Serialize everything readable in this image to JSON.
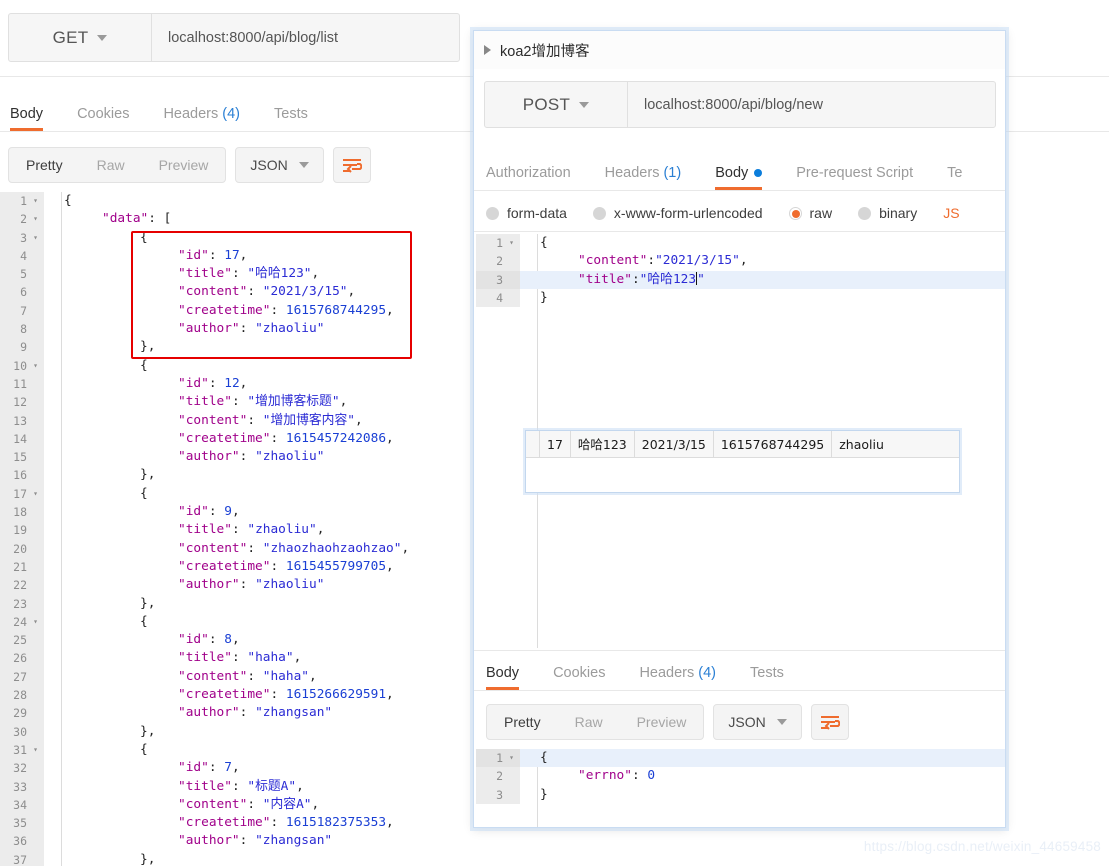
{
  "background": {
    "request": {
      "method": "GET",
      "url": "localhost:8000/api/blog/list"
    },
    "response_tabs": [
      {
        "label": "Body",
        "count": null,
        "active": true
      },
      {
        "label": "Cookies",
        "count": null,
        "active": false
      },
      {
        "label": "Headers",
        "count": "(4)",
        "active": false
      },
      {
        "label": "Tests",
        "count": null,
        "active": false
      }
    ],
    "view_modes": [
      {
        "label": "Pretty",
        "active": true
      },
      {
        "label": "Raw",
        "active": false
      },
      {
        "label": "Preview",
        "active": false
      }
    ],
    "format": "JSON",
    "wrap_icon": "word-wrap-icon",
    "body_lines": [
      {
        "n": "1",
        "fold": true,
        "indent": 0,
        "tokens": [
          [
            "p",
            "{"
          ]
        ]
      },
      {
        "n": "2",
        "fold": true,
        "indent": 1,
        "tokens": [
          [
            "k",
            "\"data\""
          ],
          [
            "p",
            ": ["
          ]
        ]
      },
      {
        "n": "3",
        "fold": true,
        "indent": 2,
        "tokens": [
          [
            "p",
            "{"
          ]
        ]
      },
      {
        "n": "4",
        "fold": false,
        "indent": 3,
        "tokens": [
          [
            "k",
            "\"id\""
          ],
          [
            "p",
            ": "
          ],
          [
            "n",
            "17"
          ],
          [
            "p",
            ","
          ]
        ]
      },
      {
        "n": "5",
        "fold": false,
        "indent": 3,
        "tokens": [
          [
            "k",
            "\"title\""
          ],
          [
            "p",
            ": "
          ],
          [
            "s",
            "\"哈哈123\""
          ],
          [
            "p",
            ","
          ]
        ]
      },
      {
        "n": "6",
        "fold": false,
        "indent": 3,
        "tokens": [
          [
            "k",
            "\"content\""
          ],
          [
            "p",
            ": "
          ],
          [
            "s",
            "\"2021/3/15\""
          ],
          [
            "p",
            ","
          ]
        ]
      },
      {
        "n": "7",
        "fold": false,
        "indent": 3,
        "tokens": [
          [
            "k",
            "\"createtime\""
          ],
          [
            "p",
            ": "
          ],
          [
            "n",
            "1615768744295"
          ],
          [
            "p",
            ","
          ]
        ]
      },
      {
        "n": "8",
        "fold": false,
        "indent": 3,
        "tokens": [
          [
            "k",
            "\"author\""
          ],
          [
            "p",
            ": "
          ],
          [
            "s",
            "\"zhaoliu\""
          ]
        ]
      },
      {
        "n": "9",
        "fold": false,
        "indent": 2,
        "tokens": [
          [
            "p",
            "},"
          ]
        ]
      },
      {
        "n": "10",
        "fold": true,
        "indent": 2,
        "tokens": [
          [
            "p",
            "{"
          ]
        ]
      },
      {
        "n": "11",
        "fold": false,
        "indent": 3,
        "tokens": [
          [
            "k",
            "\"id\""
          ],
          [
            "p",
            ": "
          ],
          [
            "n",
            "12"
          ],
          [
            "p",
            ","
          ]
        ]
      },
      {
        "n": "12",
        "fold": false,
        "indent": 3,
        "tokens": [
          [
            "k",
            "\"title\""
          ],
          [
            "p",
            ": "
          ],
          [
            "s",
            "\"增加博客标题\""
          ],
          [
            "p",
            ","
          ]
        ]
      },
      {
        "n": "13",
        "fold": false,
        "indent": 3,
        "tokens": [
          [
            "k",
            "\"content\""
          ],
          [
            "p",
            ": "
          ],
          [
            "s",
            "\"增加博客内容\""
          ],
          [
            "p",
            ","
          ]
        ]
      },
      {
        "n": "14",
        "fold": false,
        "indent": 3,
        "tokens": [
          [
            "k",
            "\"createtime\""
          ],
          [
            "p",
            ": "
          ],
          [
            "n",
            "1615457242086"
          ],
          [
            "p",
            ","
          ]
        ]
      },
      {
        "n": "15",
        "fold": false,
        "indent": 3,
        "tokens": [
          [
            "k",
            "\"author\""
          ],
          [
            "p",
            ": "
          ],
          [
            "s",
            "\"zhaoliu\""
          ]
        ]
      },
      {
        "n": "16",
        "fold": false,
        "indent": 2,
        "tokens": [
          [
            "p",
            "},"
          ]
        ]
      },
      {
        "n": "17",
        "fold": true,
        "indent": 2,
        "tokens": [
          [
            "p",
            "{"
          ]
        ]
      },
      {
        "n": "18",
        "fold": false,
        "indent": 3,
        "tokens": [
          [
            "k",
            "\"id\""
          ],
          [
            "p",
            ": "
          ],
          [
            "n",
            "9"
          ],
          [
            "p",
            ","
          ]
        ]
      },
      {
        "n": "19",
        "fold": false,
        "indent": 3,
        "tokens": [
          [
            "k",
            "\"title\""
          ],
          [
            "p",
            ": "
          ],
          [
            "s",
            "\"zhaoliu\""
          ],
          [
            "p",
            ","
          ]
        ]
      },
      {
        "n": "20",
        "fold": false,
        "indent": 3,
        "tokens": [
          [
            "k",
            "\"content\""
          ],
          [
            "p",
            ": "
          ],
          [
            "s",
            "\"zhaozhaohzaohzao\""
          ],
          [
            "p",
            ","
          ]
        ]
      },
      {
        "n": "21",
        "fold": false,
        "indent": 3,
        "tokens": [
          [
            "k",
            "\"createtime\""
          ],
          [
            "p",
            ": "
          ],
          [
            "n",
            "1615455799705"
          ],
          [
            "p",
            ","
          ]
        ]
      },
      {
        "n": "22",
        "fold": false,
        "indent": 3,
        "tokens": [
          [
            "k",
            "\"author\""
          ],
          [
            "p",
            ": "
          ],
          [
            "s",
            "\"zhaoliu\""
          ]
        ]
      },
      {
        "n": "23",
        "fold": false,
        "indent": 2,
        "tokens": [
          [
            "p",
            "},"
          ]
        ]
      },
      {
        "n": "24",
        "fold": true,
        "indent": 2,
        "tokens": [
          [
            "p",
            "{"
          ]
        ]
      },
      {
        "n": "25",
        "fold": false,
        "indent": 3,
        "tokens": [
          [
            "k",
            "\"id\""
          ],
          [
            "p",
            ": "
          ],
          [
            "n",
            "8"
          ],
          [
            "p",
            ","
          ]
        ]
      },
      {
        "n": "26",
        "fold": false,
        "indent": 3,
        "tokens": [
          [
            "k",
            "\"title\""
          ],
          [
            "p",
            ": "
          ],
          [
            "s",
            "\"haha\""
          ],
          [
            "p",
            ","
          ]
        ]
      },
      {
        "n": "27",
        "fold": false,
        "indent": 3,
        "tokens": [
          [
            "k",
            "\"content\""
          ],
          [
            "p",
            ": "
          ],
          [
            "s",
            "\"haha\""
          ],
          [
            "p",
            ","
          ]
        ]
      },
      {
        "n": "28",
        "fold": false,
        "indent": 3,
        "tokens": [
          [
            "k",
            "\"createtime\""
          ],
          [
            "p",
            ": "
          ],
          [
            "n",
            "1615266629591"
          ],
          [
            "p",
            ","
          ]
        ]
      },
      {
        "n": "29",
        "fold": false,
        "indent": 3,
        "tokens": [
          [
            "k",
            "\"author\""
          ],
          [
            "p",
            ": "
          ],
          [
            "s",
            "\"zhangsan\""
          ]
        ]
      },
      {
        "n": "30",
        "fold": false,
        "indent": 2,
        "tokens": [
          [
            "p",
            "},"
          ]
        ]
      },
      {
        "n": "31",
        "fold": true,
        "indent": 2,
        "tokens": [
          [
            "p",
            "{"
          ]
        ]
      },
      {
        "n": "32",
        "fold": false,
        "indent": 3,
        "tokens": [
          [
            "k",
            "\"id\""
          ],
          [
            "p",
            ": "
          ],
          [
            "n",
            "7"
          ],
          [
            "p",
            ","
          ]
        ]
      },
      {
        "n": "33",
        "fold": false,
        "indent": 3,
        "tokens": [
          [
            "k",
            "\"title\""
          ],
          [
            "p",
            ": "
          ],
          [
            "s",
            "\"标题A\""
          ],
          [
            "p",
            ","
          ]
        ]
      },
      {
        "n": "34",
        "fold": false,
        "indent": 3,
        "tokens": [
          [
            "k",
            "\"content\""
          ],
          [
            "p",
            ": "
          ],
          [
            "s",
            "\"内容A\""
          ],
          [
            "p",
            ","
          ]
        ]
      },
      {
        "n": "35",
        "fold": false,
        "indent": 3,
        "tokens": [
          [
            "k",
            "\"createtime\""
          ],
          [
            "p",
            ": "
          ],
          [
            "n",
            "1615182375353"
          ],
          [
            "p",
            ","
          ]
        ]
      },
      {
        "n": "36",
        "fold": false,
        "indent": 3,
        "tokens": [
          [
            "k",
            "\"author\""
          ],
          [
            "p",
            ": "
          ],
          [
            "s",
            "\"zhangsan\""
          ]
        ]
      },
      {
        "n": "37",
        "fold": false,
        "indent": 2,
        "tokens": [
          [
            "p",
            "},"
          ]
        ]
      }
    ]
  },
  "overlay": {
    "title": "koa2增加博客",
    "collapse_icon": "triangle-right-icon",
    "request": {
      "method": "POST",
      "url": "localhost:8000/api/blog/new"
    },
    "request_tabs": [
      {
        "label": "Authorization",
        "count": null,
        "active": false,
        "dot": false
      },
      {
        "label": "Headers",
        "count": "(1)",
        "active": false,
        "dot": false
      },
      {
        "label": "Body",
        "count": null,
        "active": true,
        "dot": true
      },
      {
        "label": "Pre-request Script",
        "count": null,
        "active": false,
        "dot": false
      },
      {
        "label": "Te",
        "count": null,
        "active": false,
        "dot": false
      }
    ],
    "body_types": [
      {
        "label": "form-data",
        "selected": false
      },
      {
        "label": "x-www-form-urlencoded",
        "selected": false
      },
      {
        "label": "raw",
        "selected": true
      },
      {
        "label": "binary",
        "selected": false
      }
    ],
    "body_format_clipped": "JS",
    "request_body_lines": [
      {
        "n": "1",
        "fold": true,
        "indent": 0,
        "hl": false,
        "tokens": [
          [
            "p",
            "{"
          ]
        ]
      },
      {
        "n": "2",
        "fold": false,
        "indent": 1,
        "hl": false,
        "tokens": [
          [
            "k",
            "\"content\""
          ],
          [
            "p",
            ":"
          ],
          [
            "s",
            "\"2021/3/15\""
          ],
          [
            "p",
            ","
          ]
        ]
      },
      {
        "n": "3",
        "fold": false,
        "indent": 1,
        "hl": true,
        "tokens": [
          [
            "k",
            "\"title\""
          ],
          [
            "p",
            ":"
          ],
          [
            "s",
            "\"哈哈123"
          ],
          [
            "cursor",
            "|"
          ],
          [
            "s",
            "\""
          ]
        ]
      },
      {
        "n": "4",
        "fold": false,
        "indent": 0,
        "hl": false,
        "tokens": [
          [
            "p",
            "}"
          ]
        ]
      }
    ],
    "pasted_table_row": {
      "id": "17",
      "title": "哈哈123",
      "content": "2021/3/15",
      "createtime": "1615768744295",
      "author": "zhaoliu"
    },
    "response_tabs": [
      {
        "label": "Body",
        "count": null,
        "active": true
      },
      {
        "label": "Cookies",
        "count": null,
        "active": false
      },
      {
        "label": "Headers",
        "count": "(4)",
        "active": false
      },
      {
        "label": "Tests",
        "count": null,
        "active": false
      }
    ],
    "view_modes": [
      {
        "label": "Pretty",
        "active": true
      },
      {
        "label": "Raw",
        "active": false
      },
      {
        "label": "Preview",
        "active": false
      }
    ],
    "format": "JSON",
    "wrap_icon": "word-wrap-icon",
    "response_body_lines": [
      {
        "n": "1",
        "fold": true,
        "indent": 0,
        "hl": true,
        "tokens": [
          [
            "p",
            "{"
          ]
        ]
      },
      {
        "n": "2",
        "fold": false,
        "indent": 1,
        "hl": false,
        "tokens": [
          [
            "k",
            "\"errno\""
          ],
          [
            "p",
            ": "
          ],
          [
            "n",
            "0"
          ]
        ]
      },
      {
        "n": "3",
        "fold": false,
        "indent": 0,
        "hl": false,
        "tokens": [
          [
            "p",
            "}"
          ]
        ]
      }
    ]
  },
  "annotation": {
    "highlight_box_color": "#e60000"
  },
  "watermark": {
    "text": "https://blog.csdn.net/weixin_44659458"
  }
}
